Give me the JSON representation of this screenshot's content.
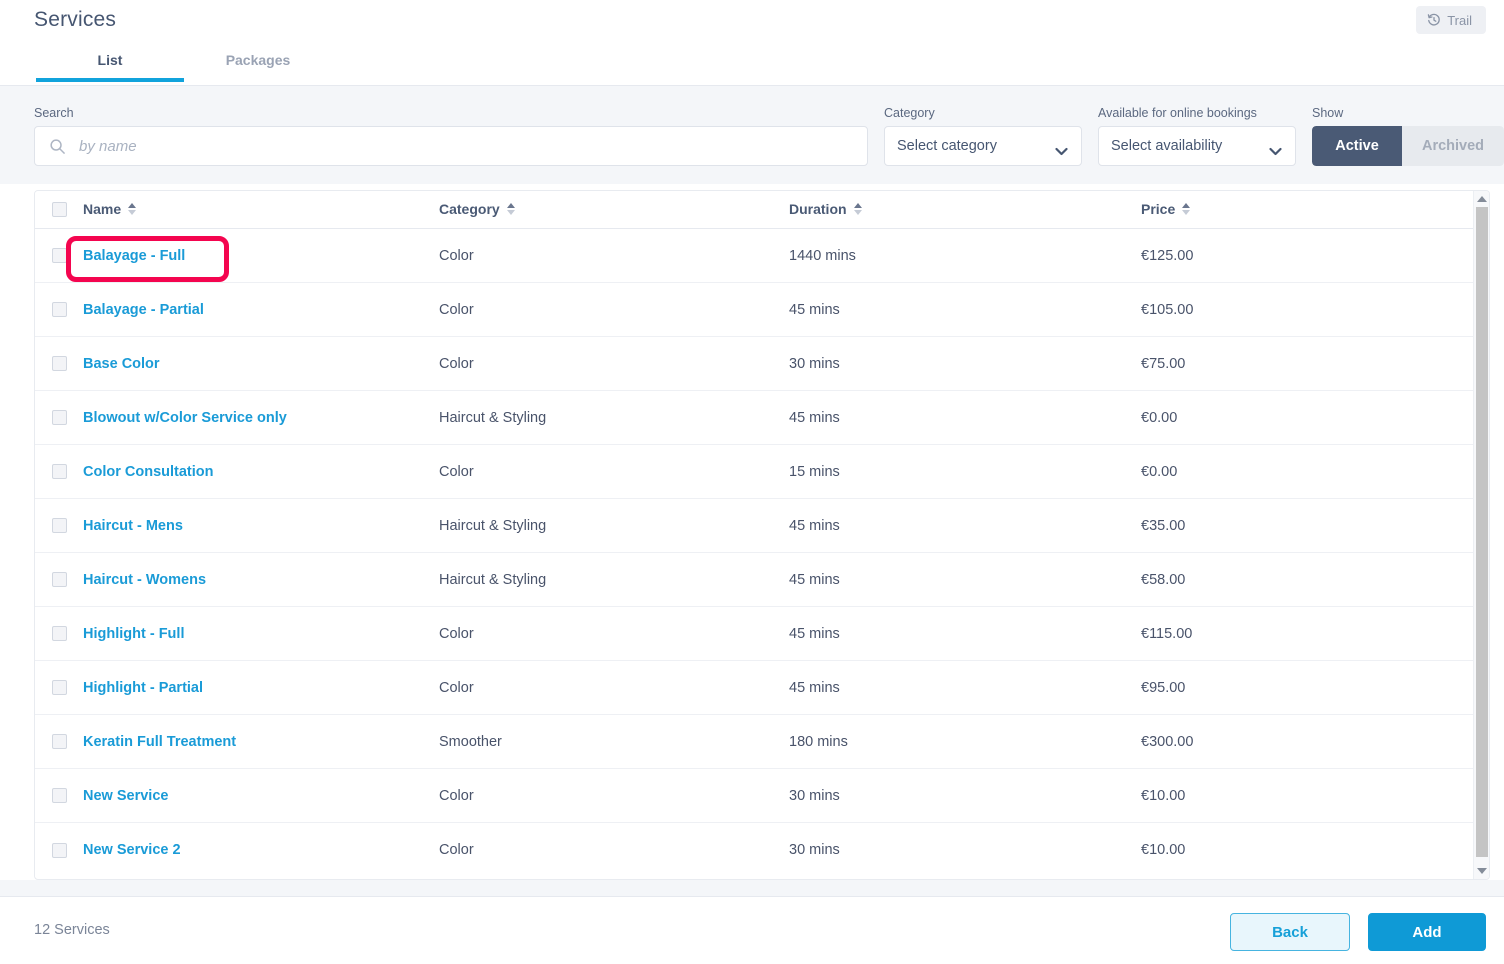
{
  "header": {
    "title": "Services",
    "trail_label": "Trail",
    "tabs": [
      {
        "label": "List",
        "active": true
      },
      {
        "label": "Packages",
        "active": false
      }
    ]
  },
  "filters": {
    "search": {
      "label": "Search",
      "placeholder": "by name",
      "value": ""
    },
    "category": {
      "label": "Category",
      "selected": "Select category"
    },
    "availability": {
      "label": "Available for online bookings",
      "selected": "Select availability"
    },
    "show": {
      "label": "Show",
      "active_label": "Active",
      "archived_label": "Archived",
      "selected": "Active"
    }
  },
  "table": {
    "columns": [
      {
        "key": "name",
        "label": "Name",
        "sortable": true
      },
      {
        "key": "category",
        "label": "Category",
        "sortable": true
      },
      {
        "key": "duration",
        "label": "Duration",
        "sortable": true
      },
      {
        "key": "price",
        "label": "Price",
        "sortable": true
      }
    ],
    "rows": [
      {
        "name": "Balayage - Full",
        "category": "Color",
        "duration": "1440 mins",
        "price": "€125.00",
        "highlighted": true
      },
      {
        "name": "Balayage - Partial",
        "category": "Color",
        "duration": "45 mins",
        "price": "€105.00",
        "highlighted": false
      },
      {
        "name": "Base Color",
        "category": "Color",
        "duration": "30 mins",
        "price": "€75.00",
        "highlighted": false
      },
      {
        "name": "Blowout w/Color Service only",
        "category": "Haircut & Styling",
        "duration": "45 mins",
        "price": "€0.00",
        "highlighted": false
      },
      {
        "name": "Color Consultation",
        "category": "Color",
        "duration": "15 mins",
        "price": "€0.00",
        "highlighted": false
      },
      {
        "name": "Haircut - Mens",
        "category": "Haircut & Styling",
        "duration": "45 mins",
        "price": "€35.00",
        "highlighted": false
      },
      {
        "name": "Haircut - Womens",
        "category": "Haircut & Styling",
        "duration": "45 mins",
        "price": "€58.00",
        "highlighted": false
      },
      {
        "name": "Highlight - Full",
        "category": "Color",
        "duration": "45 mins",
        "price": "€115.00",
        "highlighted": false
      },
      {
        "name": "Highlight - Partial",
        "category": "Color",
        "duration": "45 mins",
        "price": "€95.00",
        "highlighted": false
      },
      {
        "name": "Keratin Full Treatment",
        "category": "Smoother",
        "duration": "180 mins",
        "price": "€300.00",
        "highlighted": false
      },
      {
        "name": "New Service",
        "category": "Color",
        "duration": "30 mins",
        "price": "€10.00",
        "highlighted": false
      },
      {
        "name": "New Service 2",
        "category": "Color",
        "duration": "30 mins",
        "price": "€10.00",
        "highlighted": false
      }
    ]
  },
  "footer": {
    "count_text": "12 Services",
    "back_label": "Back",
    "add_label": "Add"
  },
  "colors": {
    "link_blue": "#1a9bd7",
    "tab_underline": "#11a3dc",
    "primary_button": "#0f9ad6",
    "toggle_active": "#4a5a75",
    "highlight_annotation": "#f4054f",
    "filter_bar_bg": "#f4f6f9"
  },
  "icons": {
    "trail": "history-icon",
    "search": "search-icon",
    "dropdown": "chevron-down-icon"
  }
}
